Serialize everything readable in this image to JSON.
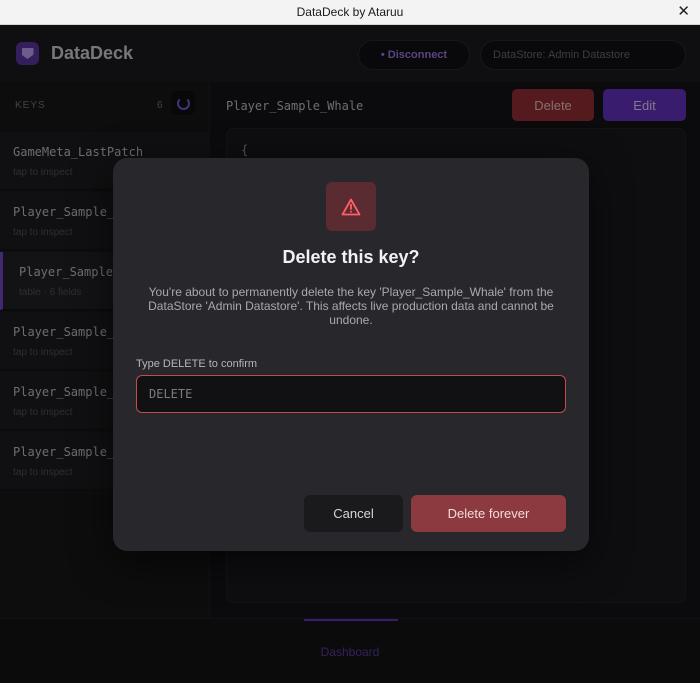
{
  "window": {
    "title": "DataDeck by Ataruu",
    "close_glyph": "✕"
  },
  "header": {
    "app_name": "DataDeck",
    "disconnect_label": "• Disconnect",
    "datastore_label": "DataStore: Admin Datastore"
  },
  "sidebar": {
    "keys_label": "KEYS",
    "keys_count": "6",
    "items": [
      {
        "name": "GameMeta_LastPatch",
        "sub": "tap to inspect"
      },
      {
        "name": "Player_Sample_",
        "sub": "tap to inspect"
      },
      {
        "name": "Player_Sample",
        "sub": "table · 6 fields"
      },
      {
        "name": "Player_Sample_",
        "sub": "tap to inspect"
      },
      {
        "name": "Player_Sample_",
        "sub": "tap to inspect"
      },
      {
        "name": "Player_Sample_",
        "sub": "tap to inspect"
      }
    ]
  },
  "main": {
    "key_title": "Player_Sample_Whale",
    "delete_label": "Delete",
    "edit_label": "Edit",
    "editor_text": "{"
  },
  "nav": {
    "dashboard_label": "Dashboard"
  },
  "modal": {
    "title": "Delete this key?",
    "description": "You're about to permanently delete the key 'Player_Sample_Whale' from the DataStore 'Admin Datastore'. This affects live production data and cannot be undone.",
    "confirm_label": "Type DELETE to confirm",
    "confirm_placeholder": "DELETE",
    "cancel_label": "Cancel",
    "delete_forever_label": "Delete forever"
  },
  "icons": {
    "warning": "warning-triangle-icon",
    "refresh": "refresh-icon",
    "logo": "datadeck-logo-icon",
    "close": "close-icon"
  },
  "colors": {
    "accent": "#6a34c8",
    "danger": "#9b3137",
    "danger_modal": "#8c3a3f"
  }
}
